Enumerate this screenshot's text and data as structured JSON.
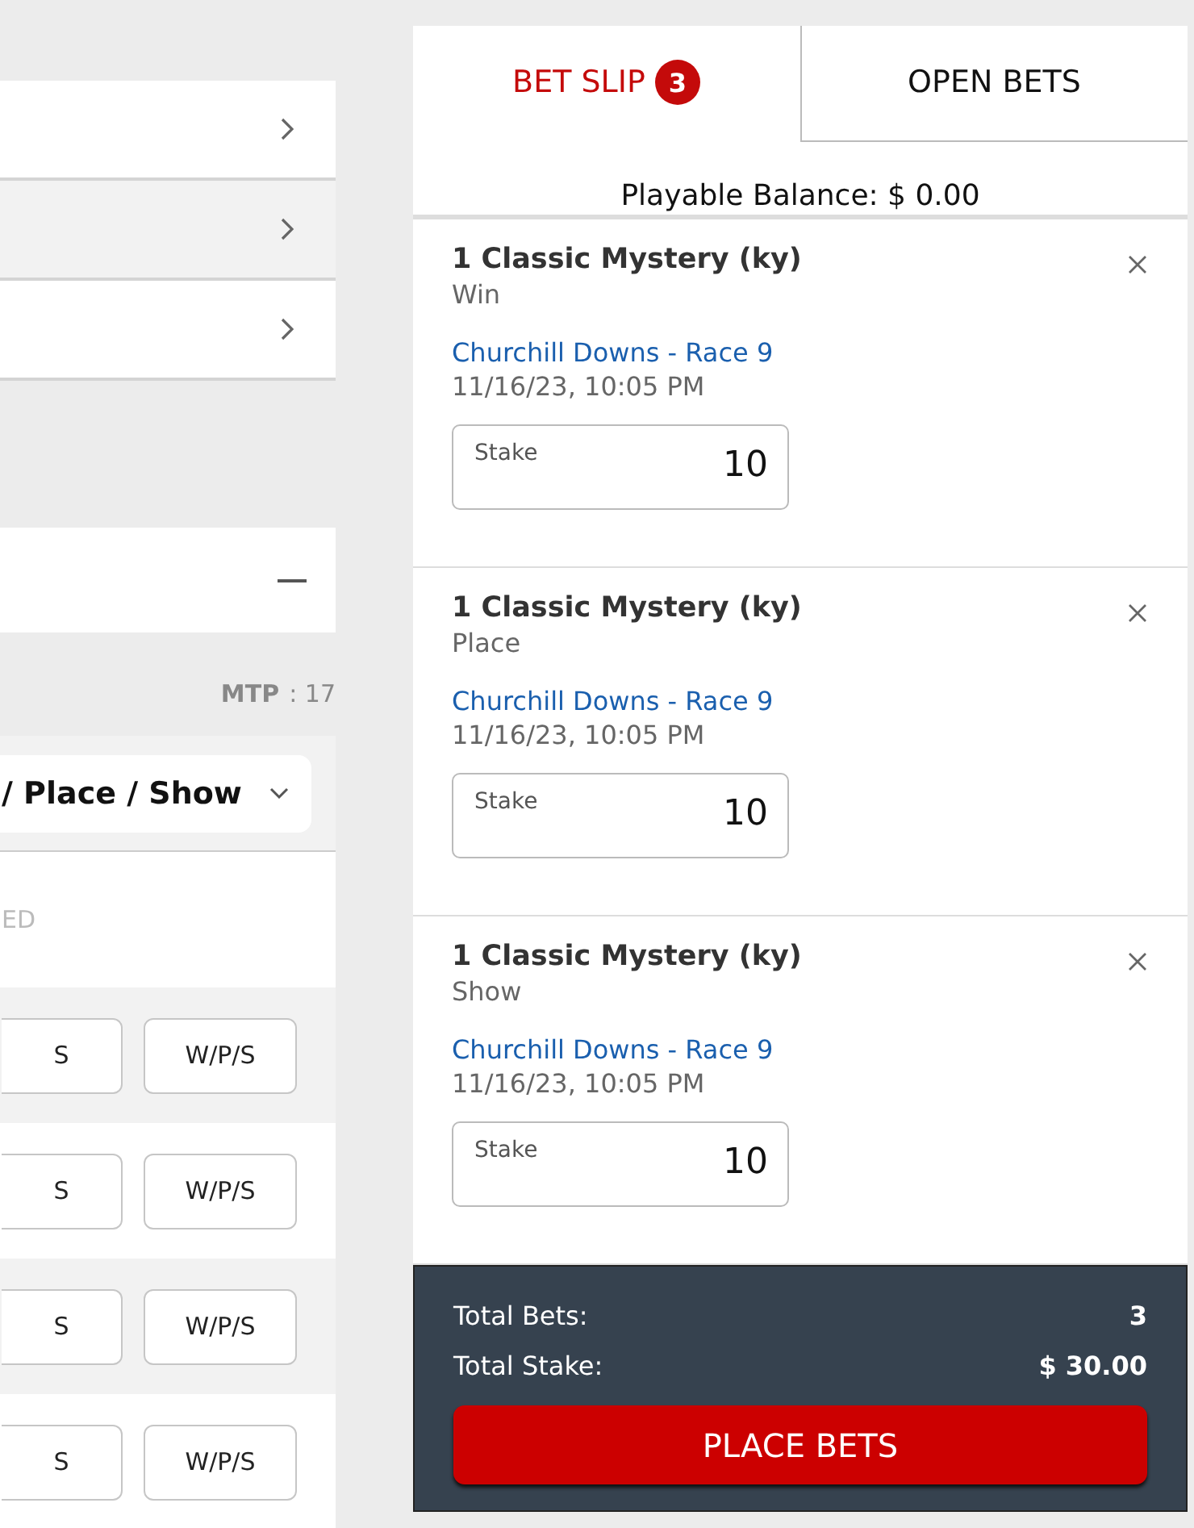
{
  "left_panel": {
    "menu_rows": [
      {
        "kind": "chevron"
      },
      {
        "kind": "chevron"
      },
      {
        "kind": "chevron"
      }
    ],
    "section": {
      "expanded": true
    },
    "mtp": {
      "label": "MTP",
      "value": ": 17"
    },
    "bet_type_dropdown": {
      "value": "/ Place / Show"
    },
    "status_text": "ED",
    "runners": [
      {
        "buttons": [
          "S",
          "W/P/S"
        ]
      },
      {
        "buttons": [
          "S",
          "W/P/S"
        ]
      },
      {
        "buttons": [
          "S",
          "W/P/S"
        ]
      },
      {
        "buttons": [
          "S",
          "W/P/S"
        ]
      }
    ]
  },
  "bet_slip": {
    "tabs": [
      {
        "label": "BET SLIP",
        "badge": "3",
        "selected": true
      },
      {
        "label": "OPEN BETS",
        "selected": false
      }
    ],
    "balance": "Playable Balance: $ 0.00",
    "bets": [
      {
        "runner": "1 Classic Mystery (ky)",
        "bet_type": "Win",
        "race": "Churchill Downs - Race 9",
        "time": "11/16/23, 10:05 PM",
        "stake_label": "Stake",
        "stake": "10"
      },
      {
        "runner": "1 Classic Mystery (ky)",
        "bet_type": "Place",
        "race": "Churchill Downs - Race 9",
        "time": "11/16/23, 10:05 PM",
        "stake_label": "Stake",
        "stake": "10"
      },
      {
        "runner": "1 Classic Mystery (ky)",
        "bet_type": "Show",
        "race": "Churchill Downs - Race 9",
        "time": "11/16/23, 10:05 PM",
        "stake_label": "Stake",
        "stake": "10"
      }
    ],
    "footer": {
      "total_bets_label": "Total Bets:",
      "total_bets": "3",
      "total_stake_label": "Total Stake:",
      "total_stake": "$ 30.00",
      "place_button": "PLACE BETS"
    }
  }
}
